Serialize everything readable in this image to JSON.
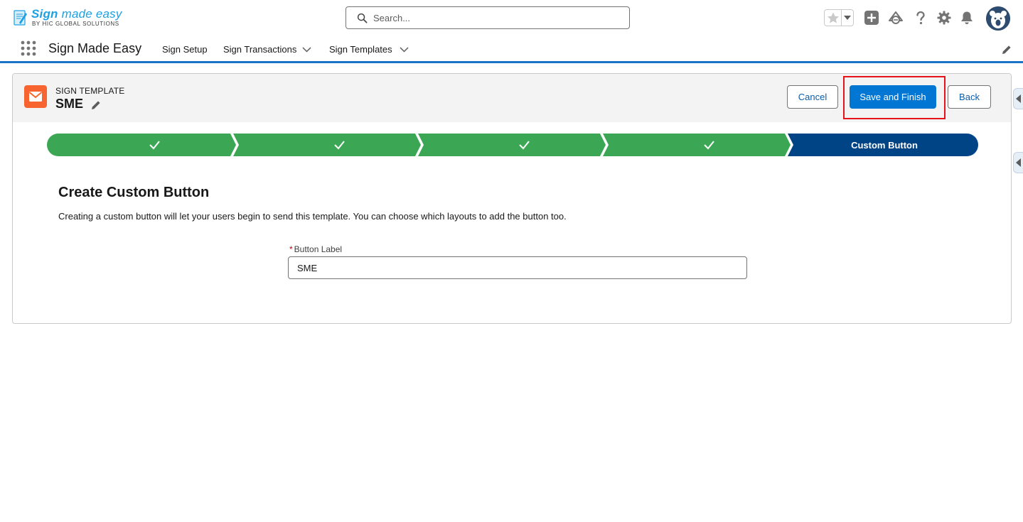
{
  "header": {
    "logo_title": "Sign",
    "logo_title_rest": "made easy",
    "logo_subtitle": "BY HIC GLOBAL SOLUTIONS",
    "search_placeholder": "Search...",
    "icons": [
      "favorites-star-icon",
      "favorites-list-caret-icon",
      "global-actions-add-icon",
      "trailhead-guidance-icon",
      "help-icon",
      "setup-gear-icon",
      "notifications-bell-icon",
      "user-avatar"
    ]
  },
  "nav": {
    "app_name": "Sign Made Easy",
    "items": [
      {
        "label": "Sign Setup",
        "has_menu": false
      },
      {
        "label": "Sign Transactions",
        "has_menu": true
      },
      {
        "label": "Sign Templates",
        "has_menu": true
      }
    ],
    "edit_icon": "pencil-icon"
  },
  "record": {
    "object_type": "SIGN TEMPLATE",
    "name": "SME",
    "icon": "email-envelope-icon",
    "icon_color": "#f8642f"
  },
  "actions": {
    "cancel": "Cancel",
    "save_finish": "Save and Finish",
    "back": "Back"
  },
  "path": {
    "steps": [
      {
        "label": "",
        "status": "complete"
      },
      {
        "label": "",
        "status": "complete"
      },
      {
        "label": "",
        "status": "complete"
      },
      {
        "label": "",
        "status": "complete"
      },
      {
        "label": "Custom Button",
        "status": "current"
      }
    ],
    "complete_color": "#3ba755",
    "current_color": "#014486"
  },
  "content": {
    "title": "Create Custom Button",
    "description": "Creating a custom button will let your users begin to send this template. You can choose which layouts to add the button too.",
    "field": {
      "label": "Button Label",
      "required_marker": "*",
      "value": "SME"
    }
  },
  "colors": {
    "brand": "#0176d3",
    "nav_border": "#1b72c9",
    "highlight": "#e8121b"
  }
}
